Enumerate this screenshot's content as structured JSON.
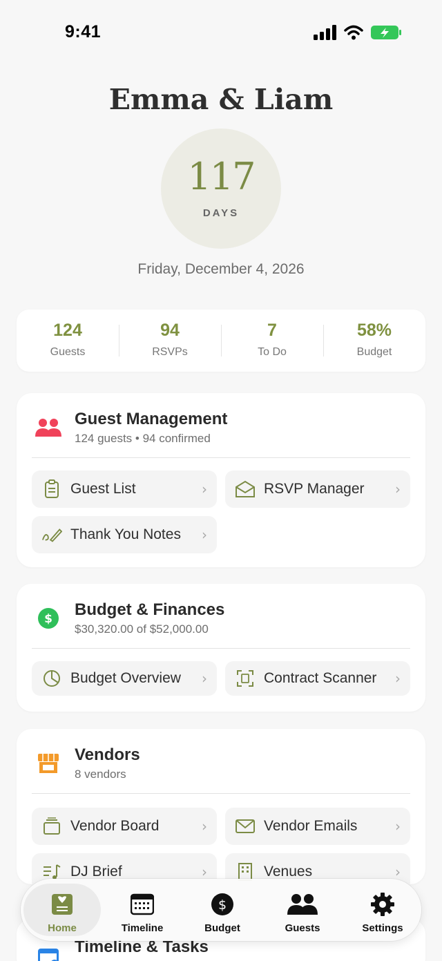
{
  "status_bar": {
    "time": "9:41"
  },
  "header": {
    "couple": "Emma & Liam",
    "countdown_value": "117",
    "countdown_unit": "DAYS",
    "date": "Friday, December 4, 2026"
  },
  "stats": [
    {
      "value": "124",
      "label": "Guests"
    },
    {
      "value": "94",
      "label": "RSVPs"
    },
    {
      "value": "7",
      "label": "To Do"
    },
    {
      "value": "58%",
      "label": "Budget"
    }
  ],
  "sections": {
    "guests": {
      "title": "Guest Management",
      "subtitle": "124 guests • 94 confirmed",
      "tiles": [
        "Guest List",
        "RSVP Manager",
        "Thank You Notes"
      ]
    },
    "budget": {
      "title": "Budget & Finances",
      "subtitle": "$30,320.00 of $52,000.00",
      "tiles": [
        "Budget Overview",
        "Contract Scanner"
      ]
    },
    "vendors": {
      "title": "Vendors",
      "subtitle": "8 vendors",
      "tiles": [
        "Vendor Board",
        "Vendor Emails",
        "DJ Brief",
        "Venues"
      ]
    },
    "timeline": {
      "title": "Timeline & Tasks"
    }
  },
  "tabbar": {
    "active": "Home",
    "tabs": [
      "Home",
      "Timeline",
      "Budget",
      "Guests",
      "Settings"
    ]
  },
  "colors": {
    "accent": "#7b8b45",
    "guest_icon": "#f0425a",
    "budget_icon": "#2fbf5a",
    "vendor_icon": "#f39a2a",
    "timeline_icon": "#2a84e6"
  },
  "icons": {
    "guests": "people-icon",
    "budget": "dollar-circle-icon",
    "vendors": "storefront-icon",
    "timeline": "calendar-icon"
  }
}
